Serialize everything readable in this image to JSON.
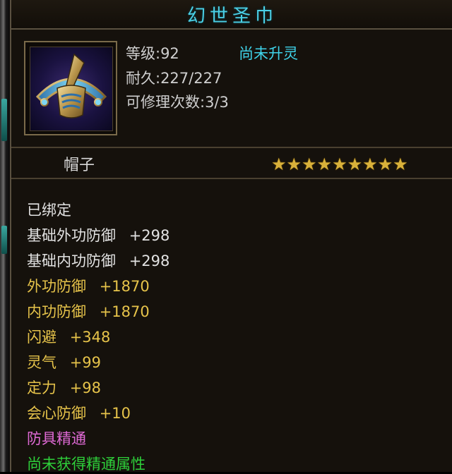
{
  "title": "幻世圣巾",
  "header": {
    "level": "等级:92",
    "spirit_status": "尚未升灵",
    "durability": "耐久:227/227",
    "repair_count": "可修理次数:3/3"
  },
  "item_type": "帽子",
  "star_count": 9,
  "icon": "hat-icon",
  "bound_status": "已绑定",
  "base_attributes": [
    {
      "label": "基础外功防御",
      "value": "+298"
    },
    {
      "label": "基础内功防御",
      "value": "+298"
    }
  ],
  "attributes": [
    {
      "label": "外功防御",
      "value": "+1870"
    },
    {
      "label": "内功防御",
      "value": "+1870"
    },
    {
      "label": "闪避",
      "value": "+348"
    },
    {
      "label": "灵气",
      "value": "+99"
    },
    {
      "label": "定力",
      "value": "+98"
    },
    {
      "label": "会心防御",
      "value": "+10"
    }
  ],
  "mastery_title": "防具精通",
  "mastery_status": "尚未获得精通属性",
  "colors": {
    "title": "#4bd0e6",
    "gold": "#e6c34a",
    "pink": "#e06ad6",
    "green": "#2ecf3a"
  }
}
